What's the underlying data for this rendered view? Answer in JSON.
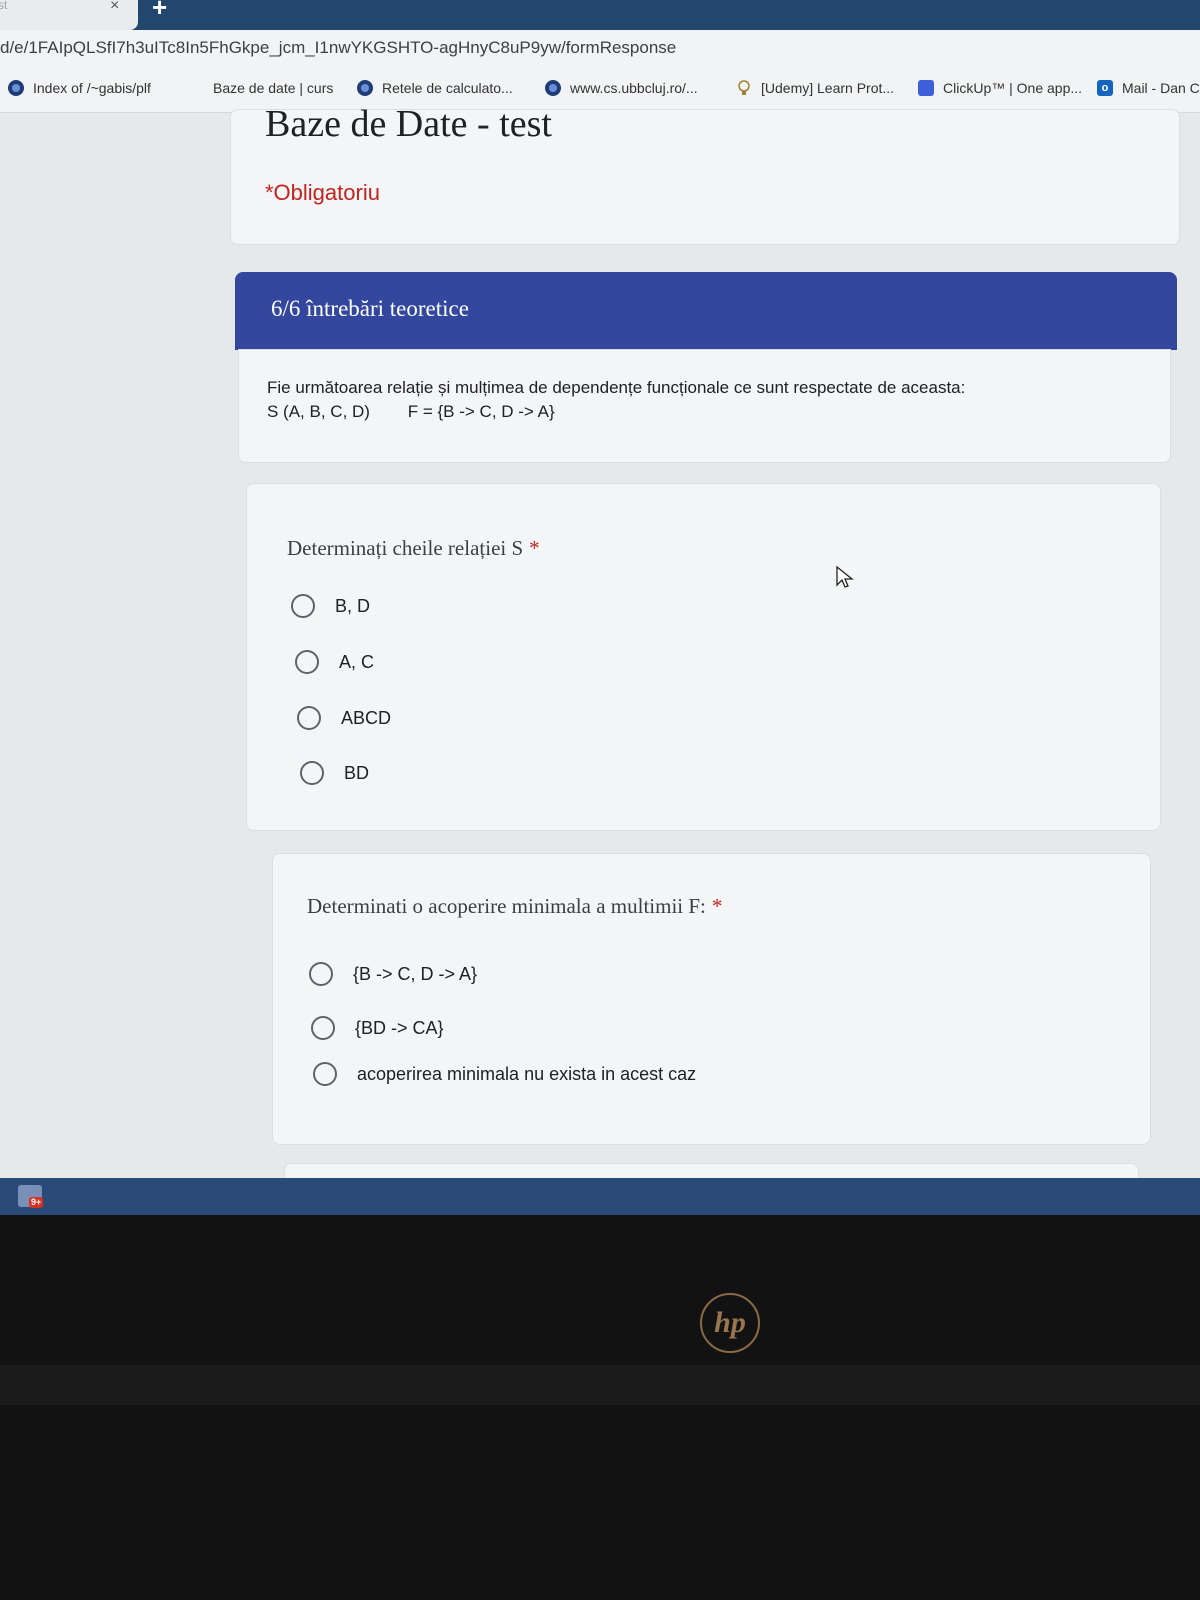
{
  "browser": {
    "tab_stub": "st",
    "tab_close": "×",
    "new_tab": "+",
    "url": "d/e/1FAIpQLSfI7h3uITc8In5FhGkpe_jcm_I1nwYKGSHTO-agHnyC8uP9yw/formResponse",
    "bookmarks": [
      {
        "label": "Index of /~gabis/plf",
        "icon": "globe-icon"
      },
      {
        "label": "Baze de date | curs",
        "icon": "none"
      },
      {
        "label": "Retele de calculato...",
        "icon": "globe-icon"
      },
      {
        "label": "www.cs.ubbcluj.ro/...",
        "icon": "globe-icon"
      },
      {
        "label": "[Udemy] Learn Prot...",
        "icon": "udemy-icon"
      },
      {
        "label": "ClickUp™ | One app...",
        "icon": "clickup-icon"
      },
      {
        "label": "Mail - Dan C",
        "icon": "outlook-icon"
      }
    ]
  },
  "form": {
    "title": "Baze de Date - test",
    "required_note": "*Obligatoriu",
    "section_title": "6/6 întrebări teoretice",
    "description": {
      "line1": "Fie următoarea relație și mulțimea de dependențe funcționale ce sunt respectate de aceasta:",
      "line2": "S (A, B, C, D)        F = {B -> C, D -> A}"
    },
    "questions": [
      {
        "title": "Determinați cheile relației S",
        "required_mark": "*",
        "options": [
          "B, D",
          "A, C",
          "ABCD",
          "BD"
        ]
      },
      {
        "title": "Determinati o acoperire minimala a multimii F:",
        "required_mark": "*",
        "options": [
          "{B -> C, D -> A}",
          "{BD -> CA}",
          "acoperirea minimala nu exista in acest caz"
        ]
      }
    ]
  },
  "taskbar": {
    "notification_badge": "9+"
  },
  "device": {
    "logo": "hp"
  },
  "colors": {
    "section_header": "#33479f",
    "required": "#c5221f",
    "tabstrip": "#23466e",
    "taskbar": "#2a4a78"
  }
}
